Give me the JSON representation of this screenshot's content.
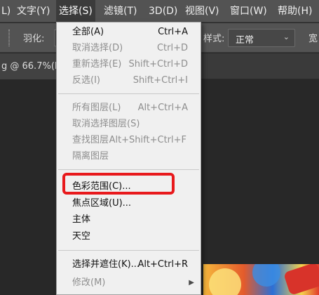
{
  "menubar": {
    "items": [
      {
        "label": "L)"
      },
      {
        "label": "文字(Y)"
      },
      {
        "label": "选择(S)"
      },
      {
        "label": "滤镜(T)"
      },
      {
        "label": "3D(D)"
      },
      {
        "label": "视图(V)"
      },
      {
        "label": "窗口(W)"
      },
      {
        "label": "帮助(H)"
      }
    ]
  },
  "options_bar": {
    "feather_label": "羽化:",
    "style_label_partial": "样式:",
    "style_value": "正常",
    "width_label_partial": "宽"
  },
  "document_tab": {
    "title_partial": "g @ 66.7%(R"
  },
  "select_menu": {
    "groups": [
      [
        {
          "label": "全部(A)",
          "shortcut": "Ctrl+A",
          "enabled": true
        },
        {
          "label": "取消选择(D)",
          "shortcut": "Ctrl+D",
          "enabled": false
        },
        {
          "label": "重新选择(E)",
          "shortcut": "Shift+Ctrl+D",
          "enabled": false
        },
        {
          "label": "反选(I)",
          "shortcut": "Shift+Ctrl+I",
          "enabled": false
        }
      ],
      [
        {
          "label": "所有图层(L)",
          "shortcut": "Alt+Ctrl+A",
          "enabled": false
        },
        {
          "label": "取消选择图层(S)",
          "shortcut": "",
          "enabled": false
        },
        {
          "label": "查找图层",
          "shortcut": "Alt+Shift+Ctrl+F",
          "enabled": false
        },
        {
          "label": "隔离图层",
          "shortcut": "",
          "enabled": false
        }
      ],
      [
        {
          "label": "色彩范围(C)...",
          "shortcut": "",
          "enabled": true,
          "highlighted": true
        },
        {
          "label": "焦点区域(U)...",
          "shortcut": "",
          "enabled": true
        },
        {
          "label": "主体",
          "shortcut": "",
          "enabled": true
        },
        {
          "label": "天空",
          "shortcut": "",
          "enabled": true
        }
      ],
      [
        {
          "label": "选择并遮住(K)...",
          "shortcut": "Alt+Ctrl+R",
          "enabled": true
        },
        {
          "label": "修改(M)",
          "shortcut": "",
          "enabled": false,
          "submenu": true
        }
      ]
    ]
  },
  "colors": {
    "menubar_bg": "#535353",
    "dropdown_bg": "#f0f0f0",
    "highlight_border": "#e8191c",
    "disabled_text": "#8e8e8e"
  }
}
